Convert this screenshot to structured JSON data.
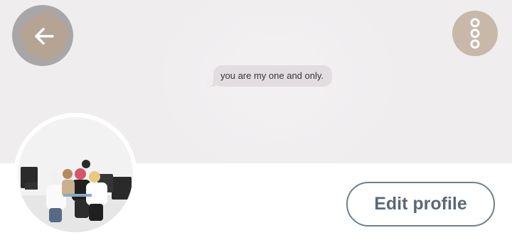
{
  "header": {
    "banner_message": "you are my one and only.",
    "back_icon": "arrow-left-icon",
    "more_icon": "more-vertical-icon"
  },
  "profile": {
    "edit_profile_label": "Edit profile"
  },
  "colors": {
    "banner_background": "#efedee",
    "back_button": "#b5a394",
    "more_button": "#c8b8aa",
    "edit_button_border": "#6f7f8c",
    "edit_button_text": "#5a6976"
  }
}
